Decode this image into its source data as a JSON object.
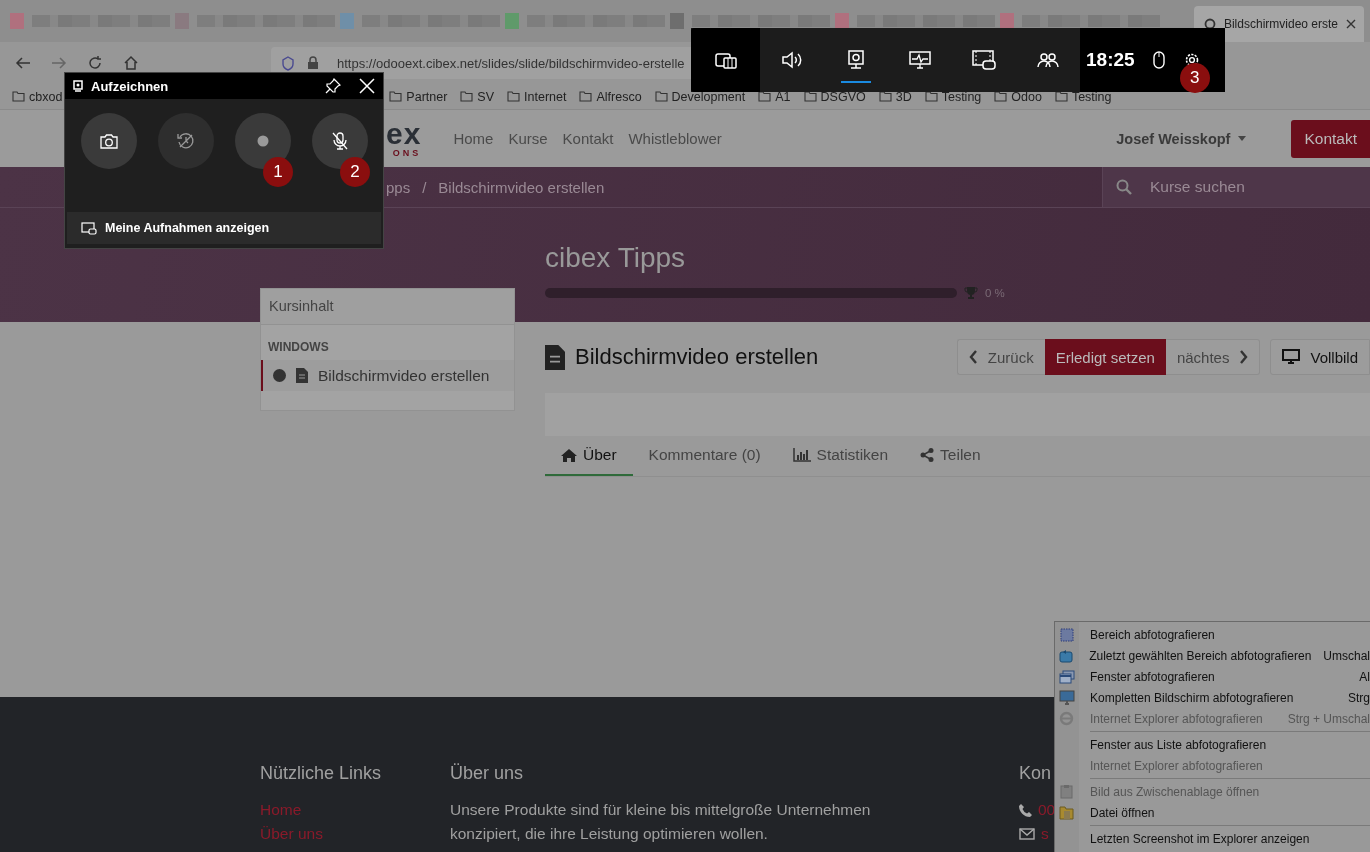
{
  "browser": {
    "blurred_tabs": [
      {
        "color": "#b0707e"
      },
      {
        "color": "#8a7a80"
      },
      {
        "color": "#6f8fa8"
      },
      {
        "color": "#5f9a6a"
      },
      {
        "color": "#6e6e6e"
      },
      {
        "color": "#b0707e"
      },
      {
        "color": "#b0707e"
      }
    ],
    "active_tab": {
      "title": "Bildschirmvideo erste"
    },
    "address": "https://odooext.cibex.net/slides/slide/bildschirmvideo-erstelle",
    "bookmarks": [
      "cbxod",
      "Partner",
      "SV",
      "Internet",
      "Alfresco",
      "Development",
      "A1",
      "DSGVO",
      "3D",
      "Testing",
      "Odoo",
      "Testing"
    ]
  },
  "site": {
    "logo_top": "ex",
    "logo_bottom": "ONS",
    "nav": [
      "Home",
      "Kurse",
      "Kontakt",
      "Whistleblower"
    ],
    "user": "Josef Weisskopf",
    "contact_button": "Kontakt",
    "breadcrumb": [
      "pps",
      "/",
      "Bildschirmvideo erstellen"
    ],
    "search": {
      "placeholder": "Kurse suchen"
    },
    "course_title": "cibex Tipps",
    "progress": {
      "level": 0,
      "reading": "0 %"
    },
    "sidebar": {
      "title": "Kursinhalt",
      "section": "WINDOWS",
      "items": [
        {
          "label": "Bildschirmvideo erstellen",
          "selected": true
        }
      ]
    },
    "lesson_title": "Bildschirmvideo erstellen",
    "buttons": [
      {
        "kind": "prev",
        "label": "Zurück"
      },
      {
        "kind": "primary",
        "label": "Erledigt setzen"
      },
      {
        "kind": "next",
        "label": "nächtes"
      },
      {
        "kind": "fullscreen",
        "label": "Vollbild"
      }
    ],
    "tabs": [
      {
        "kind": "home",
        "label": "Über",
        "selected": true
      },
      {
        "kind": "plain",
        "label": "Kommentare (0)",
        "selected": false
      },
      {
        "kind": "chart",
        "label": "Statistiken",
        "selected": false
      },
      {
        "kind": "share",
        "label": "Teilen",
        "selected": false
      }
    ],
    "footer": {
      "links_title": "Nützliche Links",
      "links": [
        "Home",
        "Über uns"
      ],
      "about_title": "Über uns",
      "about_text": "Unsere Produkte sind für kleine bis mittelgroße Unternehmen konzipiert, die ihre Leistung optimieren wollen.",
      "contact_title": "Kon",
      "contacts": [
        {
          "kind": "phone",
          "text": "00"
        },
        {
          "kind": "mail",
          "text": "s"
        }
      ]
    }
  },
  "game_bar": {
    "widgets": [
      {
        "kind": "panel",
        "selected": false
      },
      {
        "kind": "audio",
        "selected": false
      },
      {
        "kind": "capture",
        "selected": true
      },
      {
        "kind": "performance",
        "selected": false
      },
      {
        "kind": "gallery",
        "selected": false
      },
      {
        "kind": "social",
        "selected": false
      }
    ],
    "time": "18:25",
    "settings_badge": "3"
  },
  "capture_panel": {
    "title": "Aufzeichnen",
    "buttons": [
      {
        "kind": "screenshot",
        "disabled": false
      },
      {
        "kind": "record_last",
        "disabled": true
      },
      {
        "kind": "record",
        "disabled": false,
        "badge": "1"
      },
      {
        "kind": "mic_off",
        "disabled": false,
        "badge": "2"
      }
    ],
    "footer": "Meine Aufnahmen anzeigen"
  },
  "context_menu": {
    "items": [
      {
        "kind": "region",
        "label": "Bereich abfotografieren",
        "disabled": false
      },
      {
        "kind": "repeat",
        "label": "Zuletzt gewählten Bereich abfotografieren",
        "shortcut": "Umschal",
        "disabled": false
      },
      {
        "kind": "window",
        "label": "Fenster abfotografieren",
        "shortcut": "Al",
        "disabled": false
      },
      {
        "kind": "screen",
        "label": "Kompletten Bildschirm abfotografieren",
        "shortcut": "Strg",
        "disabled": false
      },
      {
        "kind": "browser",
        "label": "Internet Explorer abfotografieren",
        "shortcut": "Strg + Umschal",
        "disabled": true
      },
      {
        "kind": "separator"
      },
      {
        "kind": "text",
        "label": "Fenster aus Liste abfotografieren",
        "disabled": false
      },
      {
        "kind": "text",
        "label": "Internet Explorer abfotografieren",
        "disabled": true
      },
      {
        "kind": "separator"
      },
      {
        "kind": "clipboard",
        "label": "Bild aus Zwischenablage öffnen",
        "disabled": true
      },
      {
        "kind": "folder",
        "label": "Datei öffnen",
        "disabled": false
      },
      {
        "kind": "separator"
      },
      {
        "kind": "text",
        "label": "Letzten Screenshot im Explorer anzeigen",
        "disabled": false
      }
    ]
  }
}
